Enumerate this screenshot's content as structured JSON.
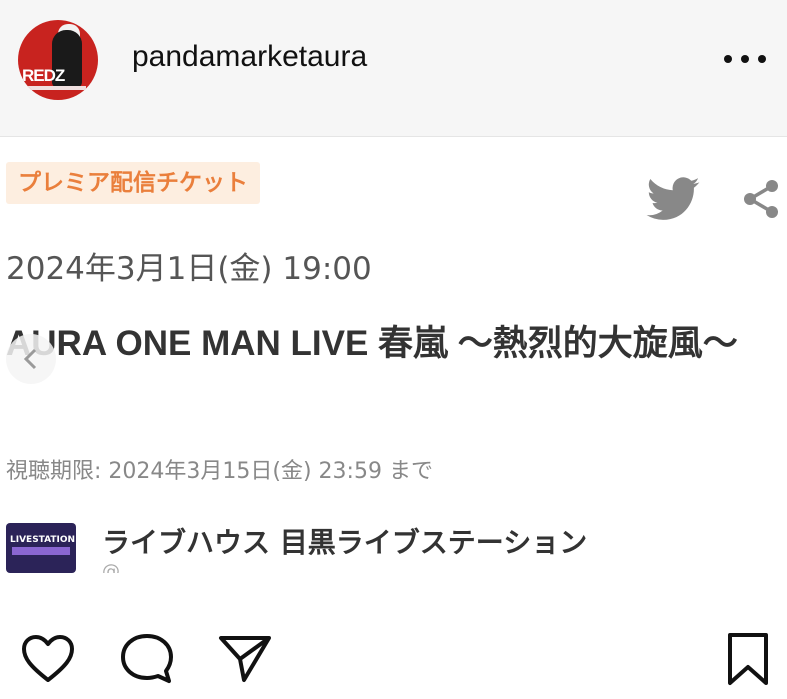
{
  "header": {
    "username": "pandamarketaura",
    "avatar_text": "REDZ",
    "more_icon": "more-horizontal-icon"
  },
  "post": {
    "badge": "プレミア配信チケット",
    "datetime": "2024年3月1日(金) 19:00",
    "title": "AURA ONE MAN LIVE 春嵐 〜熱烈的大旋風〜",
    "deadline": "視聴期限: 2024年3月15日(金) 23:59 まで",
    "venue": {
      "name": "ライブハウス 目黒ライブステーション",
      "thumb_text": "LIVESTATION",
      "sub": "@..."
    },
    "colors": {
      "badge_bg": "#fdeee0",
      "badge_text": "#ea7f3c",
      "icon_gray": "#888888"
    }
  },
  "actions": {
    "like": "heart-icon",
    "comment": "comment-icon",
    "share": "send-icon",
    "save": "bookmark-icon"
  }
}
